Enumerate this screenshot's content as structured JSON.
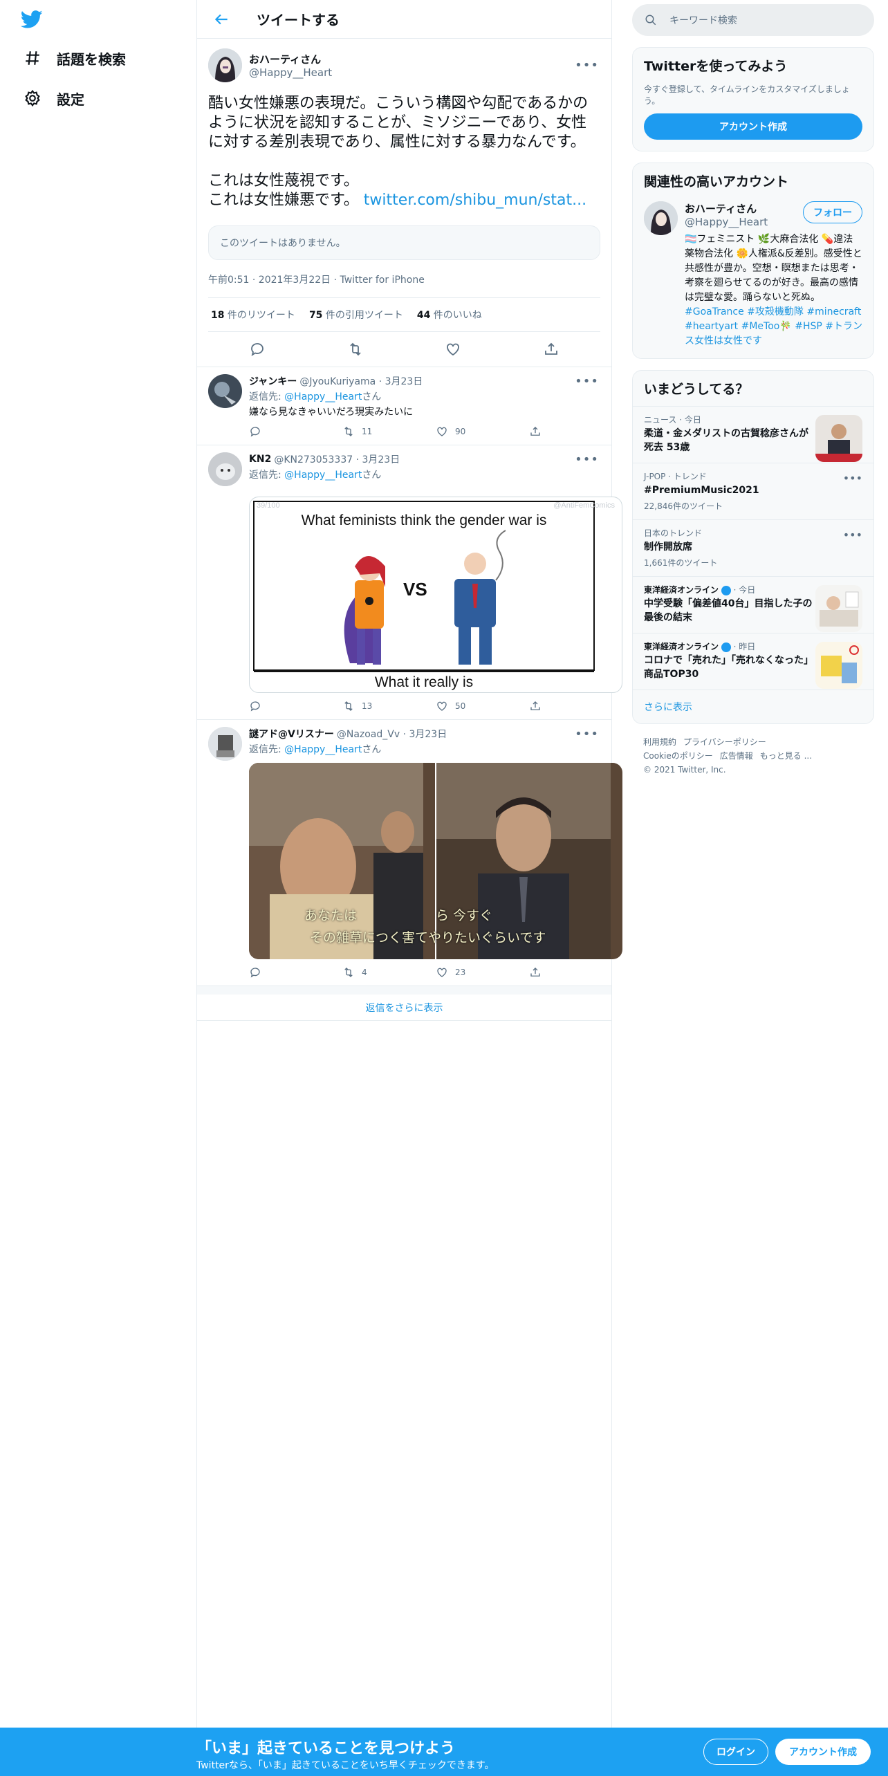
{
  "nav": {
    "explore": "話題を検索",
    "settings": "設定"
  },
  "header": {
    "title": "ツイートする"
  },
  "focal": {
    "name": "おハーティさん",
    "handle": "@Happy__Heart",
    "text": "酷い女性嫌悪の表現だ。こういう構図や勾配であるかのように状況を認知することが、ミソジニーであり、女性に対する差別表現であり、属性に対する暴力なんです。\n\nこれは女性蔑視です。\nこれは女性嫌悪です。 ",
    "link": "twitter.com/shibu_mun/stat...",
    "quoted_missing": "このツイートはありません。",
    "meta": "午前0:51 · 2021年3月22日 · Twitter for iPhone",
    "retweets": "18",
    "retweets_label": " 件のリツイート",
    "quotes": "75",
    "quotes_label": " 件の引用ツイート",
    "likes": "44",
    "likes_label": " 件のいいね"
  },
  "replies": [
    {
      "name": "ジャンキー",
      "meta": "@JyouKuriyama · 3月23日",
      "reply_to_prefix": "返信先: ",
      "reply_to_handle": "@Happy__Heart",
      "reply_to_suffix": "さん",
      "text": "嫌なら見なきゃいいだろ現実みたいに",
      "reply_count": "",
      "retweet_count": "11",
      "like_count": "90"
    },
    {
      "name": "KN2",
      "meta": "@KN273053337 · 3月23日",
      "reply_to_prefix": "返信先: ",
      "reply_to_handle": "@Happy__Heart",
      "reply_to_suffix": "さん",
      "image_top_text": "What feminists think the gender war is",
      "image_vs": "VS",
      "image_bottom_text": "What it really is",
      "image_watermark": "@AntiFemComics",
      "image_corner": "39/100",
      "reply_count": "",
      "retweet_count": "13",
      "like_count": "50"
    },
    {
      "name": "謎アド@Vリスナー",
      "meta": "@Nazoad_Vv · 3月23日",
      "reply_to_prefix": "返信先: ",
      "reply_to_handle": "@Happy__Heart",
      "reply_to_suffix": "さん",
      "subtitle_line1": "あなたは　　　　　　ら 今すぐ",
      "subtitle_line2": "その雑草につく害てやりたいぐらいです",
      "reply_count": "",
      "retweet_count": "4",
      "like_count": "23"
    }
  ],
  "show_more_replies": "返信をさらに表示",
  "sidebar": {
    "search_placeholder": "キーワード検索",
    "signup": {
      "title": "Twitterを使ってみよう",
      "desc": "今すぐ登録して、タイムラインをカスタマイズしましょう。",
      "button": "アカウント作成"
    },
    "relevant": {
      "title": "関連性の高いアカウント",
      "name": "おハーティさん",
      "handle": "@Happy__Heart",
      "follow": "フォロー",
      "bio": "🏳️‍⚧️フェミニスト 🌿大麻合法化 💊違法薬物合法化 🌼人権派&反差別。感受性と共感性が豊か。空想・瞑想または思考・考察を廻らせてるのが好き。最高の感情は完璧な愛。踊らないと死ぬ。 ",
      "bio_tags": "#GoaTrance #攻殻機動隊 #minecraft #heartyart #MeToo🎋 #HSP #トランス女性は女性です"
    },
    "trends": {
      "title": "いまどうしてる？",
      "items": [
        {
          "category": "ニュース · 今日",
          "title": "柔道・金メダリストの古賀稔彦さんが死去 53歳",
          "count": ""
        },
        {
          "category": "J-POP · トレンド",
          "title": "#PremiumMusic2021",
          "count": "22,846件のツイート"
        },
        {
          "category": "日本のトレンド",
          "title": "制作開放席",
          "count": "1,661件のツイート"
        },
        {
          "category": "東洋経済オンライン",
          "category_suffix": " · 今日",
          "title": "中学受験「偏差値40台」目指した子の最後の結末",
          "count": ""
        },
        {
          "category": "東洋経済オンライン",
          "category_suffix": " · 昨日",
          "title": "コロナで「売れた」「売れなくなった」商品TOP30",
          "count": ""
        }
      ],
      "show_more": "さらに表示"
    },
    "footer": {
      "terms": "利用規約",
      "privacy": "プライバシーポリシー",
      "cookie": "Cookieのポリシー",
      "ads": "広告情報",
      "more": "もっと見る ...",
      "copyright": "© 2021 Twitter, Inc."
    }
  },
  "bottom": {
    "title": "「いま」起きていることを見つけよう",
    "sub": "Twitterなら、「いま」起きていることをいち早くチェックできます。",
    "login": "ログイン",
    "signup": "アカウント作成"
  },
  "colors": {
    "accent": "#1da1f2",
    "link": "#1b95e0",
    "muted": "#5b7083"
  }
}
